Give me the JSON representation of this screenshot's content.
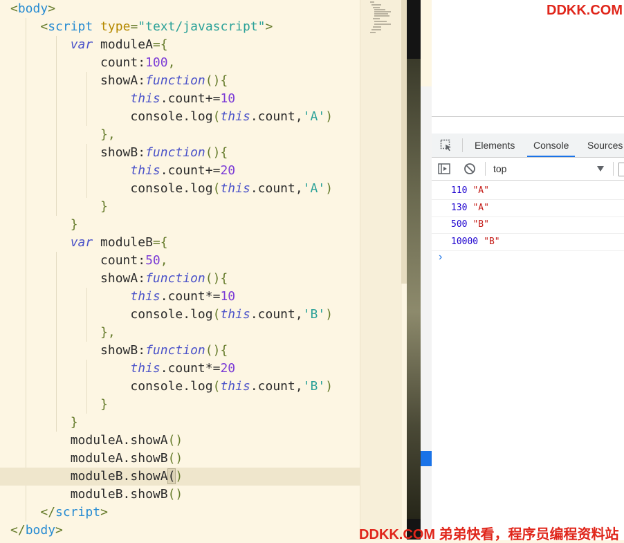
{
  "code": {
    "lines": [
      [
        {
          "t": "<",
          "c": "t-punc"
        },
        {
          "t": "body",
          "c": "t-tag"
        },
        {
          "t": ">",
          "c": "t-punc"
        }
      ],
      [
        {
          "t": "    "
        },
        {
          "t": "<",
          "c": "t-punc"
        },
        {
          "t": "script",
          "c": "t-tag"
        },
        {
          "t": " "
        },
        {
          "t": "type",
          "c": "t-attr"
        },
        {
          "t": "=",
          "c": "t-punc"
        },
        {
          "t": "\"text/javascript\"",
          "c": "t-str"
        },
        {
          "t": ">",
          "c": "t-punc"
        }
      ],
      [
        {
          "t": "        "
        },
        {
          "t": "var",
          "c": "t-kw"
        },
        {
          "t": " moduleA"
        },
        {
          "t": "={",
          "c": "t-punc"
        }
      ],
      [
        {
          "t": "            count:"
        },
        {
          "t": "100",
          "c": "t-num"
        },
        {
          "t": ",",
          "c": "t-punc"
        }
      ],
      [
        {
          "t": "            showA:"
        },
        {
          "t": "function",
          "c": "t-kw"
        },
        {
          "t": "(){",
          "c": "t-punc"
        }
      ],
      [
        {
          "t": "                "
        },
        {
          "t": "this",
          "c": "t-kw"
        },
        {
          "t": ".count+="
        },
        {
          "t": "10",
          "c": "t-num"
        }
      ],
      [
        {
          "t": "                console.log"
        },
        {
          "t": "(",
          "c": "t-punc"
        },
        {
          "t": "this",
          "c": "t-kw"
        },
        {
          "t": ".count,"
        },
        {
          "t": "'A'",
          "c": "t-str"
        },
        {
          "t": ")",
          "c": "t-punc"
        }
      ],
      [
        {
          "t": "            "
        },
        {
          "t": "},",
          "c": "t-punc"
        }
      ],
      [
        {
          "t": "            showB:"
        },
        {
          "t": "function",
          "c": "t-kw"
        },
        {
          "t": "(){",
          "c": "t-punc"
        }
      ],
      [
        {
          "t": "                "
        },
        {
          "t": "this",
          "c": "t-kw"
        },
        {
          "t": ".count+="
        },
        {
          "t": "20",
          "c": "t-num"
        }
      ],
      [
        {
          "t": "                console.log"
        },
        {
          "t": "(",
          "c": "t-punc"
        },
        {
          "t": "this",
          "c": "t-kw"
        },
        {
          "t": ".count,"
        },
        {
          "t": "'A'",
          "c": "t-str"
        },
        {
          "t": ")",
          "c": "t-punc"
        }
      ],
      [
        {
          "t": "            "
        },
        {
          "t": "}",
          "c": "t-punc"
        }
      ],
      [
        {
          "t": "        "
        },
        {
          "t": "}",
          "c": "t-punc"
        }
      ],
      [
        {
          "t": "        "
        },
        {
          "t": "var",
          "c": "t-kw"
        },
        {
          "t": " moduleB"
        },
        {
          "t": "={",
          "c": "t-punc"
        }
      ],
      [
        {
          "t": "            count:"
        },
        {
          "t": "50",
          "c": "t-num"
        },
        {
          "t": ",",
          "c": "t-punc"
        }
      ],
      [
        {
          "t": "            showA:"
        },
        {
          "t": "function",
          "c": "t-kw"
        },
        {
          "t": "(){",
          "c": "t-punc"
        }
      ],
      [
        {
          "t": "                "
        },
        {
          "t": "this",
          "c": "t-kw"
        },
        {
          "t": ".count*="
        },
        {
          "t": "10",
          "c": "t-num"
        }
      ],
      [
        {
          "t": "                console.log"
        },
        {
          "t": "(",
          "c": "t-punc"
        },
        {
          "t": "this",
          "c": "t-kw"
        },
        {
          "t": ".count,"
        },
        {
          "t": "'B'",
          "c": "t-str"
        },
        {
          "t": ")",
          "c": "t-punc"
        }
      ],
      [
        {
          "t": "            "
        },
        {
          "t": "},",
          "c": "t-punc"
        }
      ],
      [
        {
          "t": "            showB:"
        },
        {
          "t": "function",
          "c": "t-kw"
        },
        {
          "t": "(){",
          "c": "t-punc"
        }
      ],
      [
        {
          "t": "                "
        },
        {
          "t": "this",
          "c": "t-kw"
        },
        {
          "t": ".count*="
        },
        {
          "t": "20",
          "c": "t-num"
        }
      ],
      [
        {
          "t": "                console.log"
        },
        {
          "t": "(",
          "c": "t-punc"
        },
        {
          "t": "this",
          "c": "t-kw"
        },
        {
          "t": ".count,"
        },
        {
          "t": "'B'",
          "c": "t-str"
        },
        {
          "t": ")",
          "c": "t-punc"
        }
      ],
      [
        {
          "t": "            "
        },
        {
          "t": "}",
          "c": "t-punc"
        }
      ],
      [
        {
          "t": "        "
        },
        {
          "t": "}",
          "c": "t-punc"
        }
      ],
      [
        {
          "t": "        moduleA.showA"
        },
        {
          "t": "()",
          "c": "t-punc"
        }
      ],
      [
        {
          "t": "        moduleA.showB"
        },
        {
          "t": "()",
          "c": "t-punc"
        }
      ],
      [
        {
          "t": "        moduleB.showA"
        },
        {
          "t": "(",
          "c": "t-cur"
        },
        {
          "t": ")",
          "c": "t-punc"
        }
      ],
      [
        {
          "t": "        moduleB.showB"
        },
        {
          "t": "()",
          "c": "t-punc"
        }
      ],
      [
        {
          "t": "    "
        },
        {
          "t": "</",
          "c": "t-punc"
        },
        {
          "t": "script",
          "c": "t-tag"
        },
        {
          "t": ">",
          "c": "t-punc"
        }
      ],
      [
        {
          "t": "</",
          "c": "t-punc"
        },
        {
          "t": "body",
          "c": "t-tag"
        },
        {
          "t": ">",
          "c": "t-punc"
        }
      ]
    ],
    "active_line": 26
  },
  "watermark_top": "DDKK.COM",
  "watermark_bottom": "DDKK.COM 弟弟快看，程序员编程资料站",
  "devtools": {
    "tabs": [
      {
        "label": "Elements",
        "active": false
      },
      {
        "label": "Console",
        "active": true
      },
      {
        "label": "Sources",
        "active": false
      }
    ],
    "context_select": "top",
    "console_logs": [
      {
        "num": "110",
        "str": "\"A\""
      },
      {
        "num": "130",
        "str": "\"A\""
      },
      {
        "num": "500",
        "str": "\"B\""
      },
      {
        "num": "10000",
        "str": "\"B\""
      }
    ],
    "prompt": "›"
  },
  "colors": {
    "accent": "#1a73e8",
    "watermark": "#e0261b",
    "editor_bg": "#fdf6e3"
  },
  "icons": [
    "inspect-icon",
    "sidebar-toggle-icon",
    "clear-console-icon",
    "dropdown-arrow-icon",
    "console-prompt-icon"
  ]
}
